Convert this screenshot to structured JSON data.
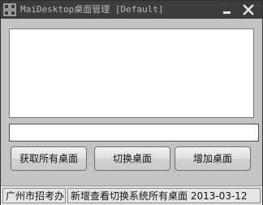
{
  "window": {
    "title": "MaiDesktop桌面管理 [Default]"
  },
  "desktop_list": {
    "items": []
  },
  "name_input": {
    "value": ""
  },
  "buttons": {
    "get_all": "获取所有桌面",
    "switch": "切换桌面",
    "add": "增加桌面"
  },
  "status": {
    "author": "广州市招考办",
    "message": "新增查看切换系统所有桌面 2013-03-12"
  },
  "icons": {
    "app": "desktop-grid-icon",
    "minimize": "minimize-icon",
    "close": "close-icon"
  },
  "colors": {
    "titlebar": "#3c3c3c",
    "title_text": "#bdbdbd",
    "client_bg": "#c4c4c4"
  }
}
